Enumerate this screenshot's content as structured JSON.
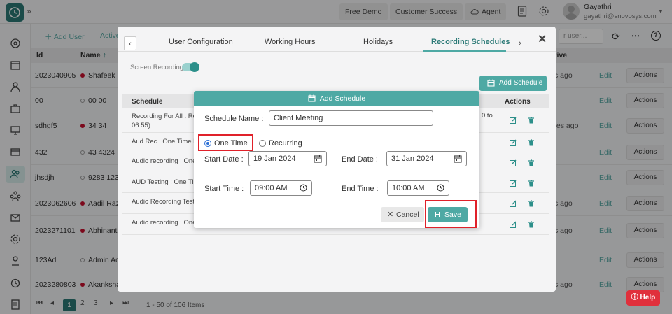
{
  "topbar": {
    "free_demo": "Free Demo",
    "customer_success": "Customer Success",
    "agent": "Agent",
    "user_name": "Gayathri",
    "user_email": "gayathri@snovosys.com"
  },
  "bg": {
    "add_user": "Add User",
    "active": "Active",
    "search_placeholder": "r user...",
    "col_id": "Id",
    "col_name": "Name",
    "col_active": "tive",
    "rows": [
      {
        "id": "2023040905",
        "name": "Shafeek S",
        "status": "red",
        "time": "s ago",
        "edit": "Edit",
        "actions": "Actions"
      },
      {
        "id": "00",
        "name": "00 00",
        "status": "hollow",
        "time": "",
        "edit": "Edit",
        "actions": "Actions"
      },
      {
        "id": "sdhgf5",
        "name": "34 34",
        "status": "red",
        "time": "tes ago",
        "edit": "Edit",
        "actions": "Actions"
      },
      {
        "id": "432",
        "name": "43 4324",
        "status": "hollow",
        "time": "",
        "edit": "Edit",
        "actions": "Actions"
      },
      {
        "id": "jhsdjh",
        "name": "9283 123",
        "status": "hollow",
        "time": "",
        "edit": "Edit",
        "actions": "Actions"
      },
      {
        "id": "2023062606",
        "name": "Aadil Razo",
        "status": "red",
        "time": "s ago",
        "edit": "Edit",
        "actions": "Actions"
      },
      {
        "id": "2023271101",
        "name": "Abhinanth",
        "status": "red",
        "time": "s ago",
        "edit": "Edit",
        "actions": "Actions"
      },
      {
        "id": "123Ad",
        "name": "Admin Ad",
        "status": "hollow",
        "time": "",
        "edit": "Edit",
        "actions": "Actions"
      },
      {
        "id": "2023280803",
        "name": "Akanksha",
        "status": "red",
        "time": "s ago",
        "edit": "Edit",
        "actions": "Actions"
      }
    ],
    "pager": {
      "pages": [
        "1",
        "2",
        "3"
      ],
      "info": "1 - 50 of 106 Items"
    },
    "help": "Help"
  },
  "modal": {
    "tabs": [
      "User Configuration",
      "Working Hours",
      "Holidays",
      "Recording Schedules"
    ],
    "active_tab": "Recording Schedules",
    "screen_recording_label": "Screen Recording",
    "add_schedule_button": "Add Schedule",
    "col_schedule": "Schedule",
    "col_actions": "Actions",
    "schedule_rows": [
      {
        "text": "Recording For All : Rec",
        "text2": "06:55)",
        "extra": "0 to"
      },
      {
        "text": "Aud Rec : One Time Re",
        "text2": "",
        "extra": ""
      },
      {
        "text": "Audio recording : One T",
        "text2": "",
        "extra": ""
      },
      {
        "text": "AUD Testing : One Tim",
        "text2": "",
        "extra": ""
      },
      {
        "text": "Audio Recording Testin",
        "text2": "",
        "extra": ""
      },
      {
        "text": "Audio recording : One T",
        "text2": "",
        "extra": ""
      }
    ]
  },
  "dialog": {
    "title": "Add Schedule",
    "schedule_name_label": "Schedule Name :",
    "schedule_name_value": "Client Meeting",
    "one_time_label": "One Time",
    "recurring_label": "Recurring",
    "selected": "One Time",
    "start_date_label": "Start Date :",
    "start_date_value": "19 Jan 2024",
    "end_date_label": "End Date :",
    "end_date_value": "31 Jan 2024",
    "start_time_label": "Start Time :",
    "start_time_value": "09:00 AM",
    "end_time_label": "End Time :",
    "end_time_value": "10:00 AM",
    "cancel_button": "Cancel",
    "save_button": "Save"
  },
  "colors": {
    "accent": "#4ea9a4",
    "brand": "#2c7a77",
    "highlight": "#e0212a",
    "help": "#e0303c"
  }
}
